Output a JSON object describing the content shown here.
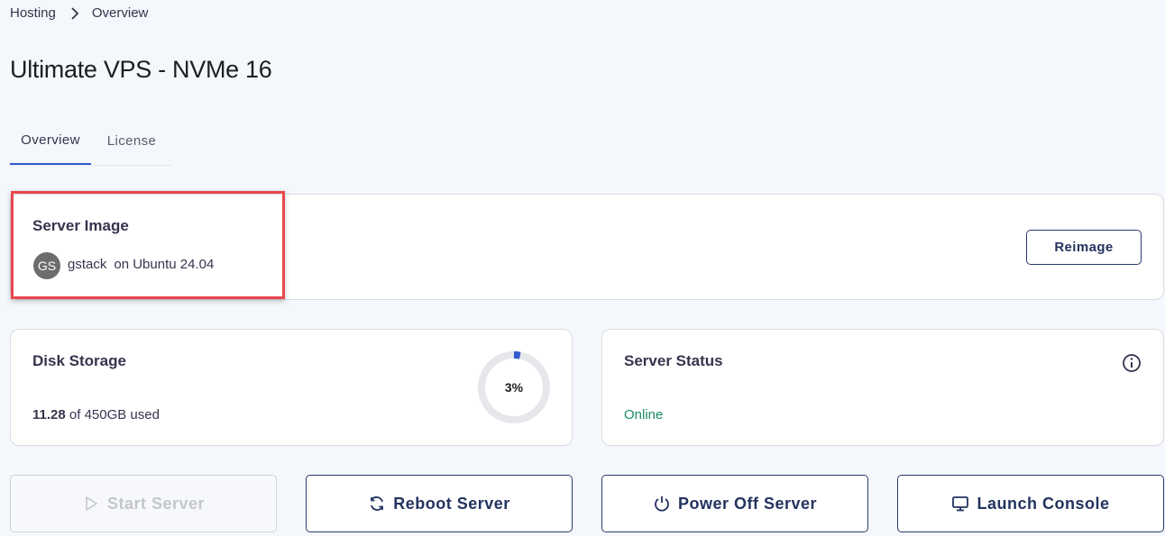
{
  "breadcrumb": {
    "parent": "Hosting",
    "current": "Overview",
    "separator_icon": "chevron-right-icon"
  },
  "page": {
    "title": "Ultimate VPS - NVMe 16"
  },
  "tabs": [
    {
      "label": "Overview",
      "active": true
    },
    {
      "label": "License",
      "active": false
    }
  ],
  "server_image": {
    "title": "Server Image",
    "avatar_initials": "GS",
    "app_name": "gstack",
    "os_text": "on Ubuntu 24.04",
    "reimage_label": "Reimage"
  },
  "disk_storage": {
    "title": "Disk Storage",
    "used": "11.28",
    "usage_suffix": "of 450GB used",
    "percent_label": "3%",
    "percent": 3
  },
  "server_status": {
    "title": "Server Status",
    "status": "Online",
    "info_icon": "info-icon"
  },
  "actions": {
    "start": "Start Server",
    "reboot": "Reboot Server",
    "power_off": "Power Off Server",
    "console": "Launch Console"
  },
  "colors": {
    "accent": "#2f5bd0",
    "highlight": "#e8474e",
    "online": "#1a8a6a",
    "button_text": "#23335f"
  }
}
